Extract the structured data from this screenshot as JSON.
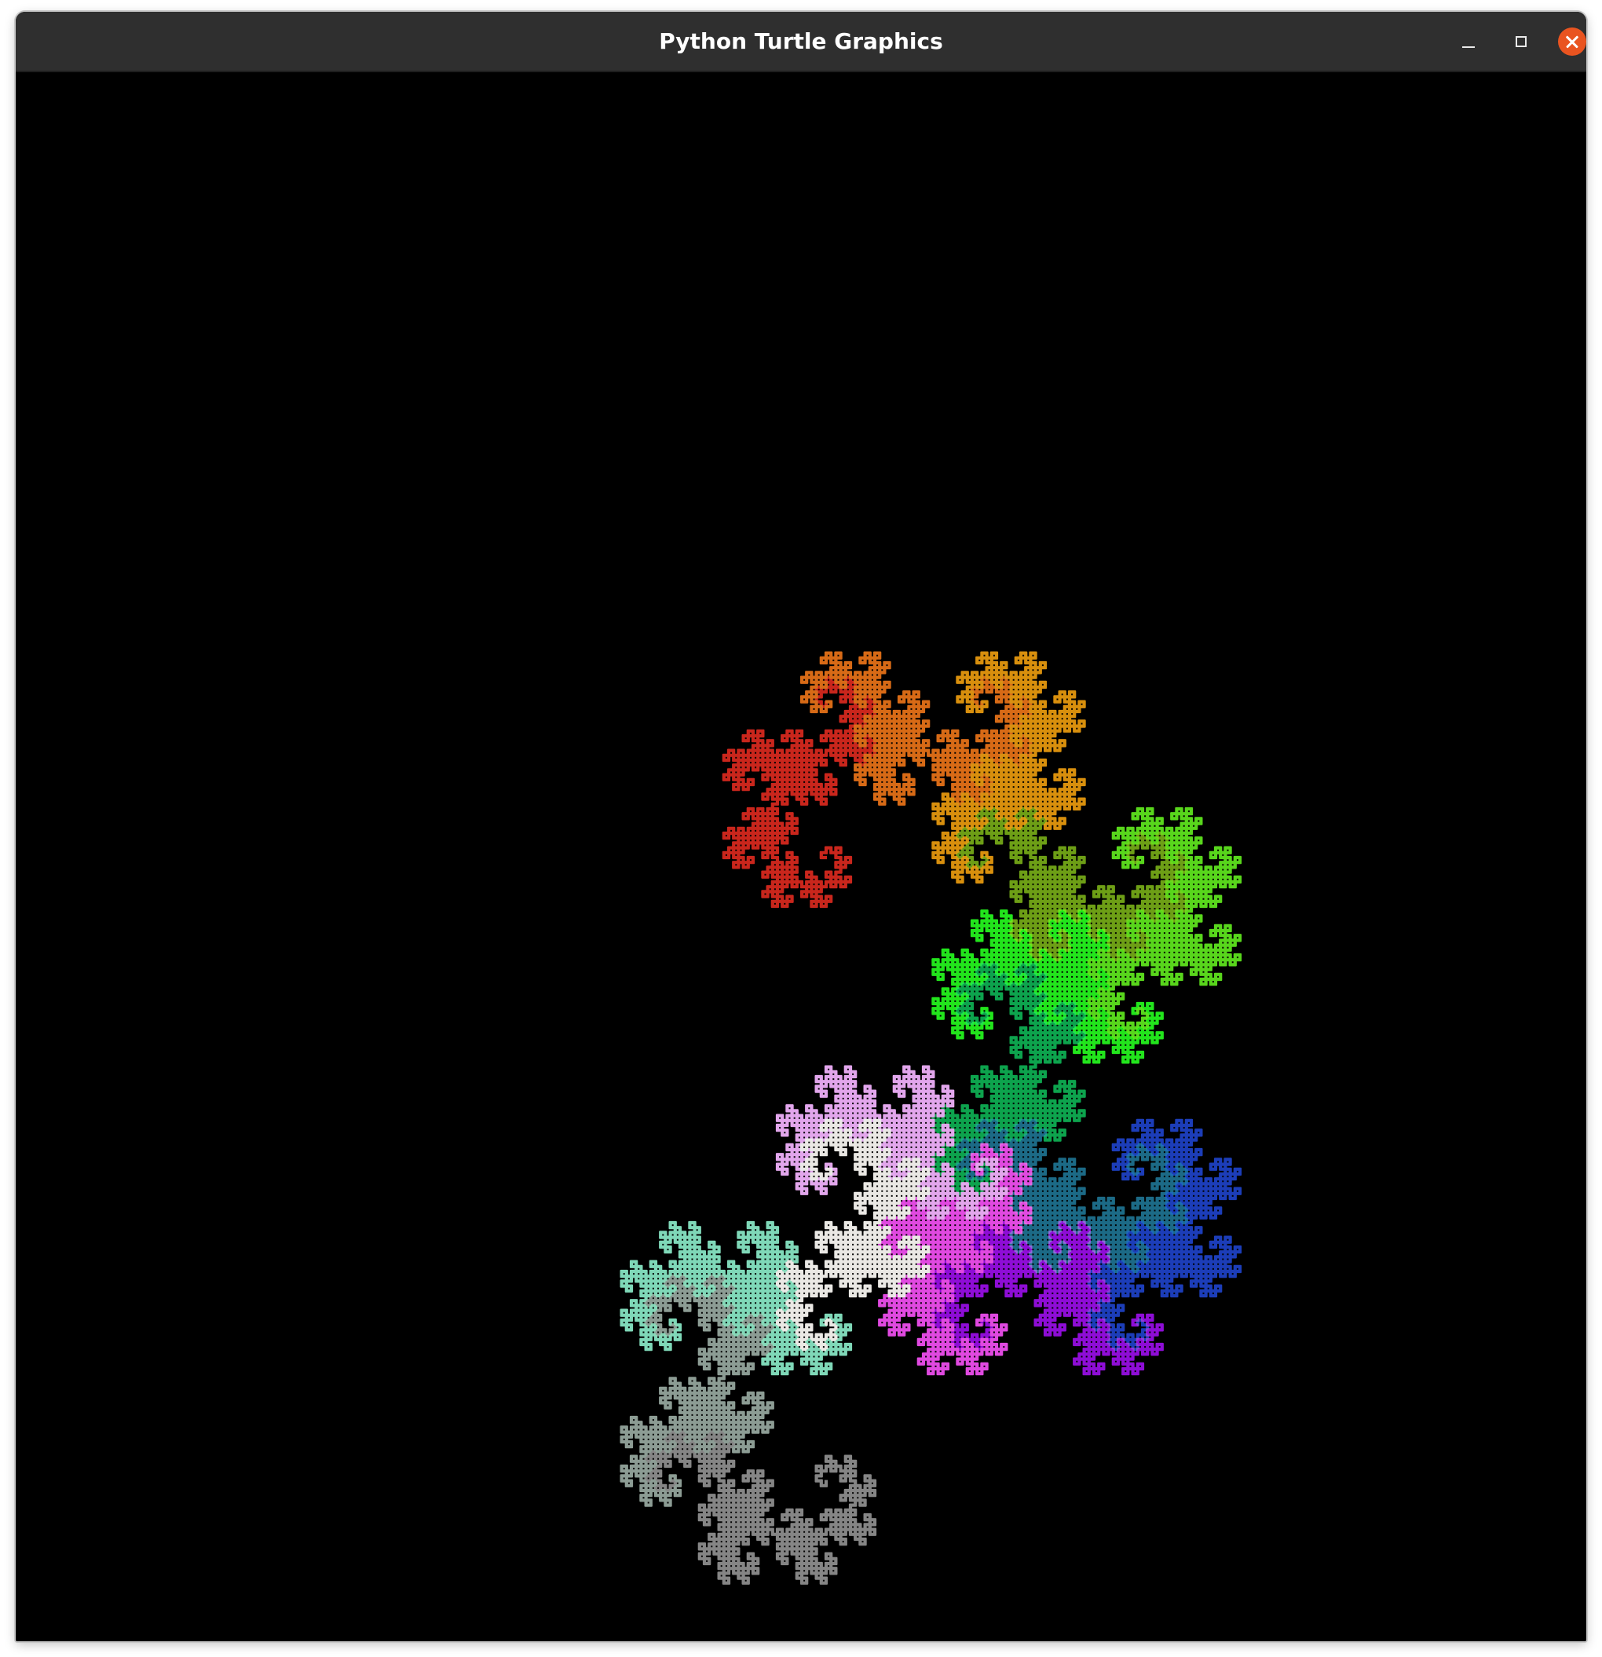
{
  "window": {
    "title": "Python Turtle Graphics"
  },
  "controls": {
    "minimize_icon": "minimize-icon",
    "maximize_icon": "maximize-icon",
    "close_icon": "close-icon",
    "close_color": "#e95420"
  },
  "canvas": {
    "background": "#000000",
    "drawing": "dragon-curve-fractal",
    "palette": [
      "#c9251f",
      "#d76a18",
      "#d88f10",
      "#6d9e12",
      "#58d61a",
      "#20e51d",
      "#0fa34e",
      "#1a6a86",
      "#1c3cb8",
      "#8e10d6",
      "#e048e0",
      "#e2a6ec",
      "#eae8e4",
      "#7fd8b8",
      "#8c9c94",
      "#858585"
    ]
  }
}
